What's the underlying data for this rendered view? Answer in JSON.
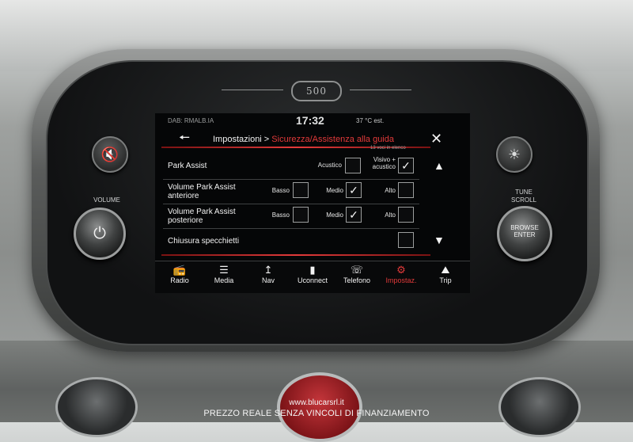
{
  "logo": {
    "text": "500"
  },
  "controls": {
    "mute_icon": "speaker-mute-icon",
    "brightness_icon": "brightness-icon",
    "volume_label": "VOLUME",
    "power_icon": "power-icon",
    "tune_label": "TUNE\nSCROLL",
    "browse_line1": "BROWSE",
    "browse_line2": "ENTER"
  },
  "status": {
    "source": "DAB: RMALB.IA",
    "time": "17:32",
    "temperature": "37 °C est."
  },
  "header": {
    "back_icon": "back-arrow-icon",
    "crumb_root": "Impostazioni >",
    "crumb_current": "Sicurezza/Assistenza alla guida",
    "close_icon": "close-icon",
    "item_count": "13 voci in elenco"
  },
  "rows": [
    {
      "name": "Park Assist",
      "options": [
        {
          "label": "Acustico",
          "checked": false
        },
        {
          "label": "Visivo + acustico",
          "checked": true
        }
      ]
    },
    {
      "name": "Volume Park Assist anteriore",
      "options": [
        {
          "label": "Basso",
          "checked": false
        },
        {
          "label": "Medio",
          "checked": true
        },
        {
          "label": "Alto",
          "checked": false
        }
      ]
    },
    {
      "name": "Volume Park Assist posteriore",
      "options": [
        {
          "label": "Basso",
          "checked": false
        },
        {
          "label": "Medio",
          "checked": true
        },
        {
          "label": "Alto",
          "checked": false
        }
      ]
    },
    {
      "name": "Chiusura specchietti",
      "options": [
        {
          "label": "",
          "checked": false
        }
      ]
    }
  ],
  "scroll": {
    "up_icon": "scroll-up-icon",
    "down_icon": "scroll-down-icon"
  },
  "nav": [
    {
      "label": "Radio",
      "icon": "radio-icon",
      "active": false
    },
    {
      "label": "Media",
      "icon": "media-icon",
      "active": false
    },
    {
      "label": "Nav",
      "icon": "nav-icon",
      "active": false
    },
    {
      "label": "Uconnect",
      "icon": "uconnect-icon",
      "active": false
    },
    {
      "label": "Telefono",
      "icon": "phone-icon",
      "active": false
    },
    {
      "label": "Impostaz.",
      "icon": "settings-icon",
      "active": true
    },
    {
      "label": "Trip",
      "icon": "car-icon",
      "active": false
    }
  ],
  "watermark": {
    "site": "www.blucarsrl.it",
    "slogan": "PREZZO REALE SENZA VINCOLI DI FINANZIAMENTO"
  },
  "colors": {
    "accent": "#e23a3a",
    "screen_bg": "#050607"
  }
}
